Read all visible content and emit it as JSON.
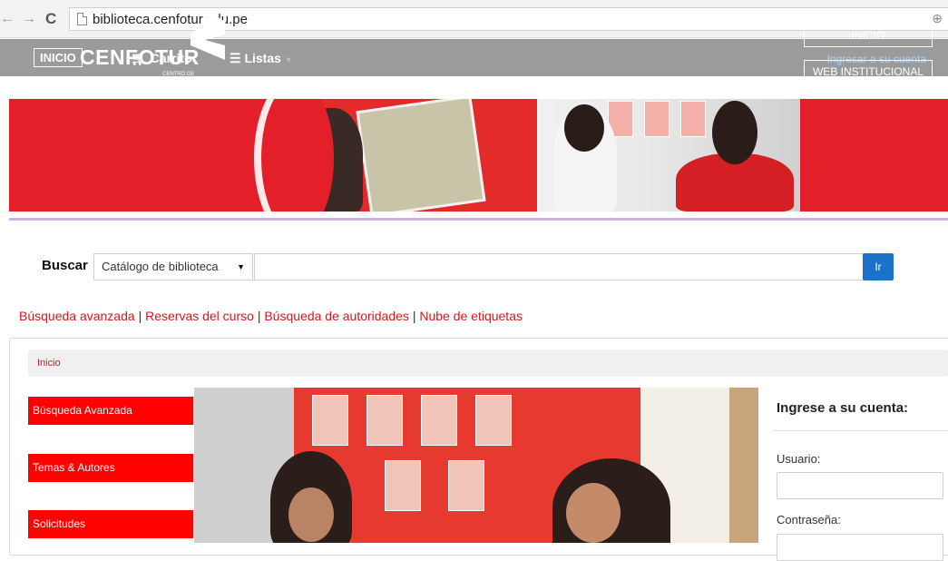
{
  "browser": {
    "back_icon": "back-arrow-icon",
    "forward_icon": "forward-arrow-icon",
    "reload_icon": "reload-icon",
    "url": "biblioteca.cenfotur.edu.pe"
  },
  "topnav": {
    "home": "INICIO",
    "cart": "Carrito",
    "lists": "Listas",
    "login": "Ingresar a su cuenta"
  },
  "banner": {
    "logo": "CENFOTUR",
    "logo_sub": "CENTRO DE FORMACIÓN EN TURISMO",
    "btn_home": "INICIO",
    "btn_web": "WEB INSTITUCIONAL"
  },
  "search": {
    "label": "Buscar",
    "catalog": "Catálogo de biblioteca",
    "button": "Ir"
  },
  "links": {
    "advanced": "Búsqueda avanzada",
    "course": "Reservas del curso",
    "authorities": "Búsqueda de autoridades",
    "tags": "Nube de etiquetas",
    "sep": "|"
  },
  "breadcrumb": {
    "home": "Inicio"
  },
  "sidebar": {
    "items": [
      "Búsqueda Avanzada",
      "Temas & Autores",
      "Solicitudes"
    ]
  },
  "login": {
    "title": "Ingrese a su cuenta:",
    "user_label": "Usuario:",
    "pass_label": "Contraseña:"
  },
  "colors": {
    "brand_red": "#e3202a",
    "link_red": "#d11a1a",
    "nav_gray": "#9b9b9b",
    "button_blue": "#1a73c9"
  }
}
